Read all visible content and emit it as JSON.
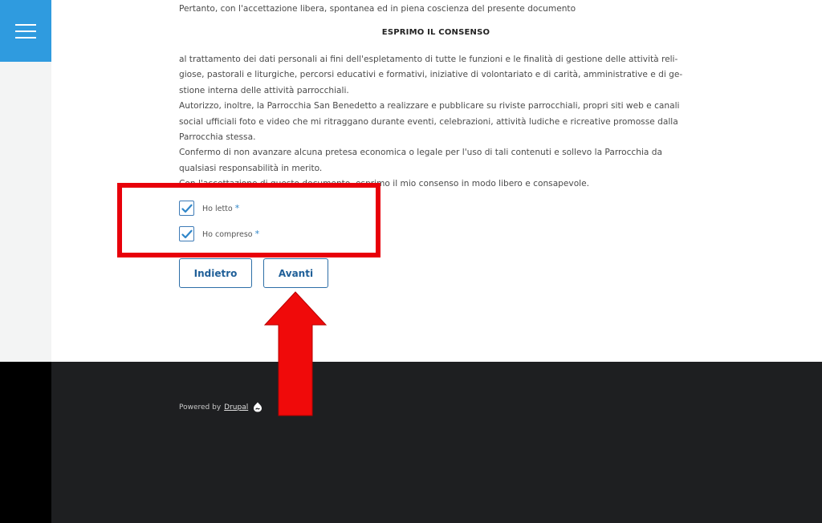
{
  "intro_text": "Pertanto, con l'accettazione libera, spontanea ed in piena coscienza del presente documento",
  "heading": "ESPRIMO IL CONSENSO",
  "body_lines": [
    "al trattamento dei dati personali ai fini dell'espletamento di tutte le funzioni e le finalità di gestione delle attività reli-",
    "giose, pastorali e liturgiche, percorsi educativi e formativi, iniziative di volontariato e di carità, amministrative e di ge-",
    "stione interna delle attività parrocchiali.",
    "Autorizzo, inoltre, la Parrocchia San Benedetto a realizzare e pubblicare su riviste parrocchiali, propri siti web e canali",
    "social ufficiali foto e video che mi ritraggano durante eventi, celebrazioni, attività ludiche e ricreative promosse dalla",
    "Parrocchia stessa.",
    "Confermo di non avanzare alcuna pretesa economica o legale per l'uso di tali contenuti e sollevo la Parrocchia da",
    "qualsiasi responsabilità in merito.",
    "Con l'accettazione di questo documento, esprimo il mio consenso in modo libero e consapevole."
  ],
  "checkboxes": [
    {
      "label": "Ho letto",
      "required_mark": "*",
      "checked": true
    },
    {
      "label": "Ho compreso",
      "required_mark": "*",
      "checked": true
    }
  ],
  "buttons": {
    "back_label": "Indietro",
    "next_label": "Avanti"
  },
  "footer": {
    "powered_by": "Powered by",
    "drupal_link": "Drupal"
  },
  "icons": {
    "menu": "hamburger-menu-icon",
    "check": "checkmark-icon",
    "drupal": "drupal-drop-icon",
    "annotation": "red-up-arrow"
  },
  "colors": {
    "menu_bg": "#2f9bdf",
    "accent_blue": "#2d6ea7",
    "highlight_red": "#e8000a",
    "footer_bg": "#1e1f21"
  }
}
